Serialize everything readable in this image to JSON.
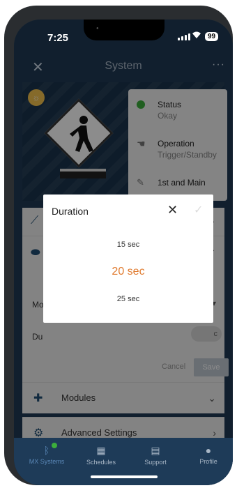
{
  "status_bar": {
    "time": "7:25",
    "battery": "99"
  },
  "header": {
    "title": "System",
    "close_symbol": "✕",
    "more_symbol": "···"
  },
  "hero_info": {
    "status_label": "Status",
    "status_value": "Okay",
    "operation_label": "Operation",
    "operation_value": "Trigger/Standby",
    "location_value": "1st and Main"
  },
  "panel": {
    "row_mode_label": "Mo",
    "row_duration_label": "Du",
    "partial_value": "c",
    "cancel_label": "Cancel",
    "save_label": "Save"
  },
  "list": [
    {
      "label": "Modules"
    },
    {
      "label": "Advanced Settings"
    }
  ],
  "dialog": {
    "title": "Duration",
    "close_symbol": "✕",
    "check_symbol": "✓",
    "options": [
      "15 sec",
      "20 sec",
      "25 sec"
    ],
    "selected": "20 sec"
  },
  "tabs": [
    {
      "label": "MX Systems",
      "icon": "bluetooth-icon"
    },
    {
      "label": "Schedules",
      "icon": "calendar-icon"
    },
    {
      "label": "Support",
      "icon": "chat-icon"
    },
    {
      "label": "Profile",
      "icon": "person-icon"
    }
  ],
  "colors": {
    "accent_orange": "#e07a2e",
    "nav_blue": "#1e3b58",
    "status_green": "#3cae3c"
  }
}
